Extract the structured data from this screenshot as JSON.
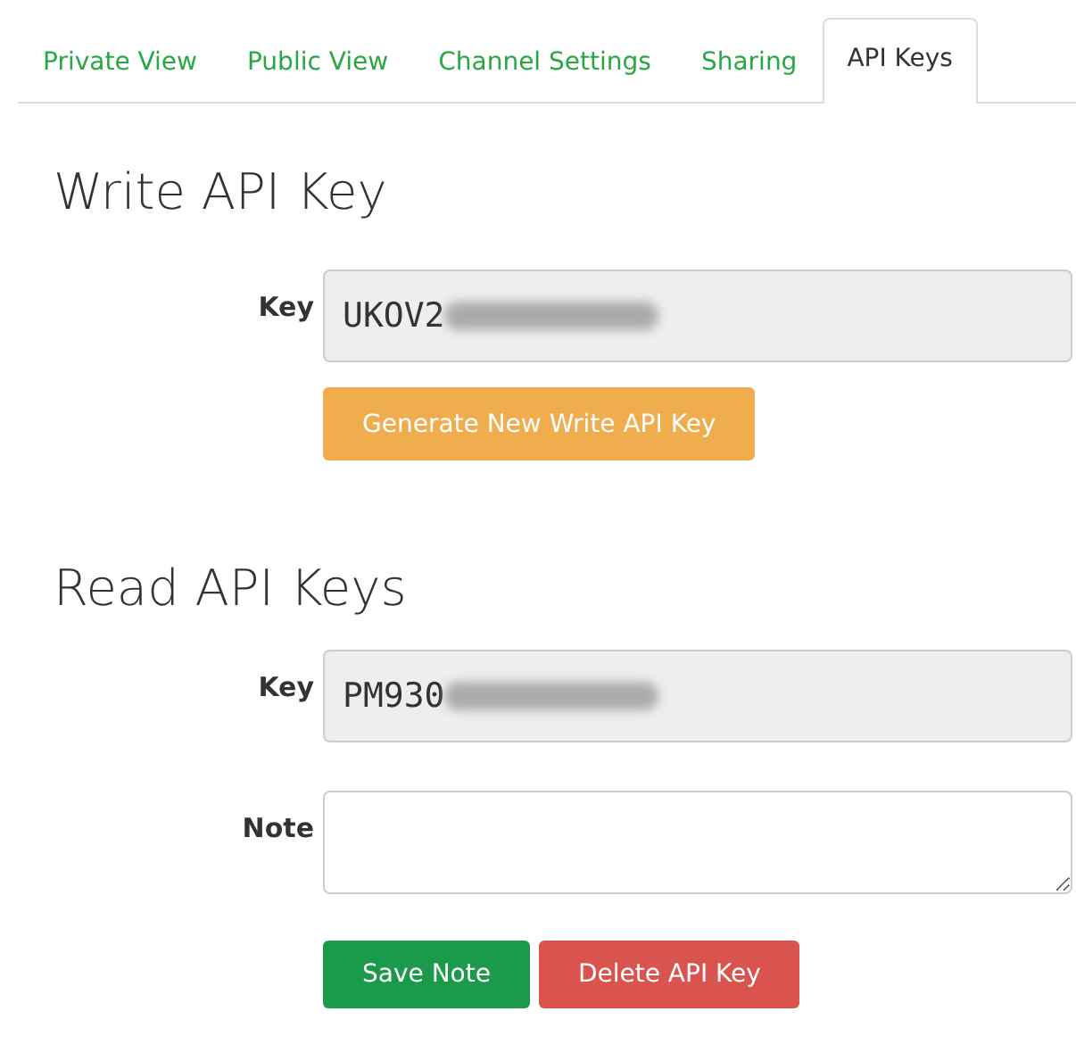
{
  "tabs": [
    {
      "label": "Private View",
      "selected": false
    },
    {
      "label": "Public View",
      "selected": false
    },
    {
      "label": "Channel Settings",
      "selected": false
    },
    {
      "label": "Sharing",
      "selected": false
    },
    {
      "label": "API Keys",
      "selected": true
    }
  ],
  "write_section": {
    "heading": "Write API Key",
    "key_label": "Key",
    "key_value": "UKOV2",
    "generate_button": "Generate New Write API Key"
  },
  "read_section": {
    "heading": "Read API Keys",
    "key_label": "Key",
    "key_value": "PM930",
    "note_label": "Note",
    "save_button": "Save Note",
    "delete_button": "Delete API Key"
  }
}
